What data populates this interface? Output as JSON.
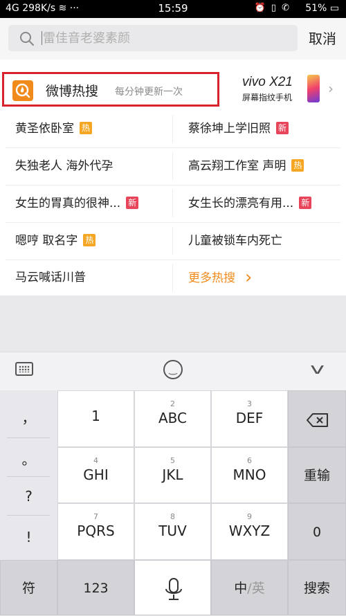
{
  "status_bar": {
    "network": "4G",
    "speed": "298K/s",
    "time": "15:59",
    "battery": "51%",
    "icons": [
      "wifi-icon",
      "alarm-icon",
      "vibrate-icon",
      "hd-call-icon"
    ]
  },
  "search": {
    "placeholder": "雷佳音老婆素颜",
    "cancel_label": "取消"
  },
  "hot_search": {
    "title": "微博热搜",
    "subtitle": "每分钟更新一次",
    "ad_brand": "vivo X21",
    "ad_caption": "屏幕指纹手机",
    "rows": [
      [
        {
          "text": "黄圣依卧室",
          "badge": "热"
        },
        {
          "text": "蔡徐坤上学旧照",
          "badge": "新"
        }
      ],
      [
        {
          "text": "失独老人 海外代孕",
          "badge": ""
        },
        {
          "text": "高云翔工作室 声明",
          "badge": "热"
        }
      ],
      [
        {
          "text": "女生的胃真的很神...",
          "badge": "新"
        },
        {
          "text": "女生长的漂亮有用...",
          "badge": "新"
        }
      ],
      [
        {
          "text": "嗯哼 取名字",
          "badge": "热"
        },
        {
          "text": "儿童被锁车内死亡",
          "badge": ""
        }
      ],
      [
        {
          "text": "马云喊话川普",
          "badge": ""
        },
        {
          "text": "更多热搜",
          "badge": ""
        }
      ]
    ]
  },
  "keyboard": {
    "punctuation": [
      "，",
      "。",
      "?",
      "!"
    ],
    "keys": [
      {
        "num": "",
        "label": "1"
      },
      {
        "num": "2",
        "label": "ABC"
      },
      {
        "num": "3",
        "label": "DEF"
      },
      {
        "num": "4",
        "label": "GHI"
      },
      {
        "num": "5",
        "label": "JKL"
      },
      {
        "num": "6",
        "label": "MNO"
      },
      {
        "num": "7",
        "label": "PQRS"
      },
      {
        "num": "8",
        "label": "TUV"
      },
      {
        "num": "9",
        "label": "WXYZ"
      }
    ],
    "reenter_label": "重输",
    "zero_label": "0",
    "symbol_label": "符",
    "num_label": "123",
    "lang_label_a": "中",
    "lang_sep": "/",
    "lang_label_b": "英",
    "search_label": "搜索"
  }
}
